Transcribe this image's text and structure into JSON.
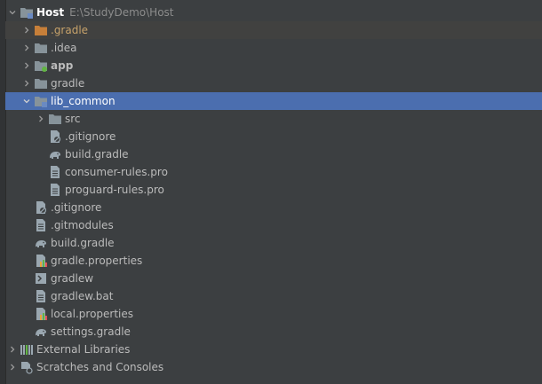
{
  "project_tree": {
    "root": {
      "label": "Host",
      "path": "E:\\StudyDemo\\Host"
    },
    "items": [
      {
        "label": ".gradle"
      },
      {
        "label": ".idea"
      },
      {
        "label": "app"
      },
      {
        "label": "gradle"
      },
      {
        "label": "lib_common"
      },
      {
        "label": "src"
      },
      {
        "label": ".gitignore"
      },
      {
        "label": "build.gradle"
      },
      {
        "label": "consumer-rules.pro"
      },
      {
        "label": "proguard-rules.pro"
      },
      {
        "label": ".gitignore"
      },
      {
        "label": ".gitmodules"
      },
      {
        "label": "build.gradle"
      },
      {
        "label": "gradle.properties"
      },
      {
        "label": "gradlew"
      },
      {
        "label": "gradlew.bat"
      },
      {
        "label": "local.properties"
      },
      {
        "label": "settings.gradle"
      },
      {
        "label": "External Libraries"
      },
      {
        "label": "Scratches and Consoles"
      }
    ]
  },
  "colors": {
    "background": "#3c3f41",
    "selection": "#4b6eaf",
    "text": "#bbbbbb",
    "folder": "#87939a",
    "excluded_folder": "#c77f39"
  },
  "icons": {
    "folder": "folder-icon",
    "excluded_folder": "excluded-folder-icon",
    "module_folder": "module-folder-icon",
    "gradle": "gradle-elephant-icon",
    "gitignore": "ignore-file-icon",
    "text": "text-file-icon",
    "properties": "properties-file-icon",
    "terminal": "terminal-icon",
    "libraries": "libraries-icon",
    "scratches": "scratches-icon"
  }
}
